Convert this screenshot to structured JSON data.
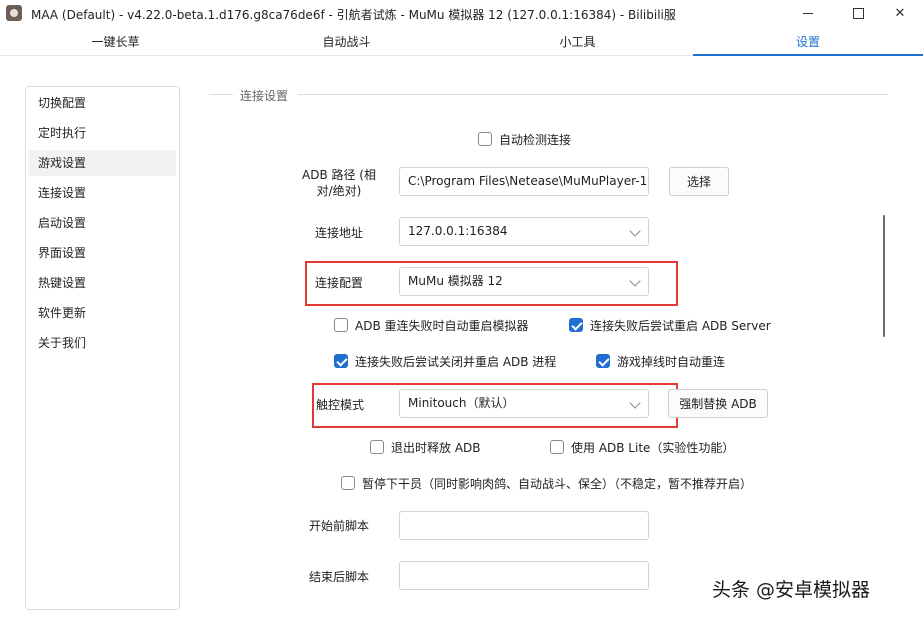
{
  "window": {
    "title": "MAA (Default) - v4.22.0-beta.1.d176.g8ca76de6f - 引航者试炼 - MuMu 模拟器 12 (127.0.0.1:16384) - Bilibili服",
    "icon": "maa-app-icon"
  },
  "tabs": [
    {
      "label": "一键长草"
    },
    {
      "label": "自动战斗"
    },
    {
      "label": "小工具"
    },
    {
      "label": "设置"
    }
  ],
  "sidebar": {
    "items": [
      {
        "label": "切换配置"
      },
      {
        "label": "定时执行"
      },
      {
        "label": "游戏设置"
      },
      {
        "label": "连接设置"
      },
      {
        "label": "启动设置"
      },
      {
        "label": "界面设置"
      },
      {
        "label": "热键设置"
      },
      {
        "label": "软件更新"
      },
      {
        "label": "关于我们"
      }
    ],
    "active_index": 2
  },
  "settings": {
    "section_title": "连接设置",
    "auto_detect": {
      "label": "自动检测连接",
      "checked": false
    },
    "adb_path": {
      "label": "ADB 路径 (相对/绝对)",
      "label_line1": "ADB 路径 (相",
      "label_line2": "对/绝对)",
      "value": "C:\\Program Files\\Netease\\MuMuPlayer-1",
      "button": "选择"
    },
    "address": {
      "label": "连接地址",
      "value": "127.0.0.1:16384"
    },
    "connection_config": {
      "label": "连接配置",
      "value": "MuMu 模拟器 12"
    },
    "checkboxes_row1": [
      {
        "label": "ADB 重连失败时自动重启模拟器",
        "checked": false
      },
      {
        "label": "连接失败后尝试重启 ADB Server",
        "checked": true
      }
    ],
    "checkboxes_row2": [
      {
        "label": "连接失败后尝试关闭并重启 ADB 进程",
        "checked": true
      },
      {
        "label": "游戏掉线时自动重连",
        "checked": true
      }
    ],
    "touch_mode": {
      "label": "触控模式",
      "value": "Minitouch（默认）",
      "button": "强制替换 ADB"
    },
    "checkboxes_row3": [
      {
        "label": "退出时释放 ADB",
        "checked": false
      },
      {
        "label": "使用 ADB Lite（实验性功能）",
        "checked": false
      }
    ],
    "pause_operator": {
      "label": "暂停下干员（同时影响肉鸽、自动战斗、保全）（不稳定，暂不推荐开启）",
      "checked": false
    },
    "pre_script": {
      "label": "开始前脚本",
      "value": ""
    },
    "post_script": {
      "label": "结束后脚本",
      "value": ""
    }
  },
  "watermark": {
    "text": "头条 @安卓模拟器"
  },
  "colors": {
    "accent": "#1f6fd1",
    "highlight_box": "#e53935"
  }
}
